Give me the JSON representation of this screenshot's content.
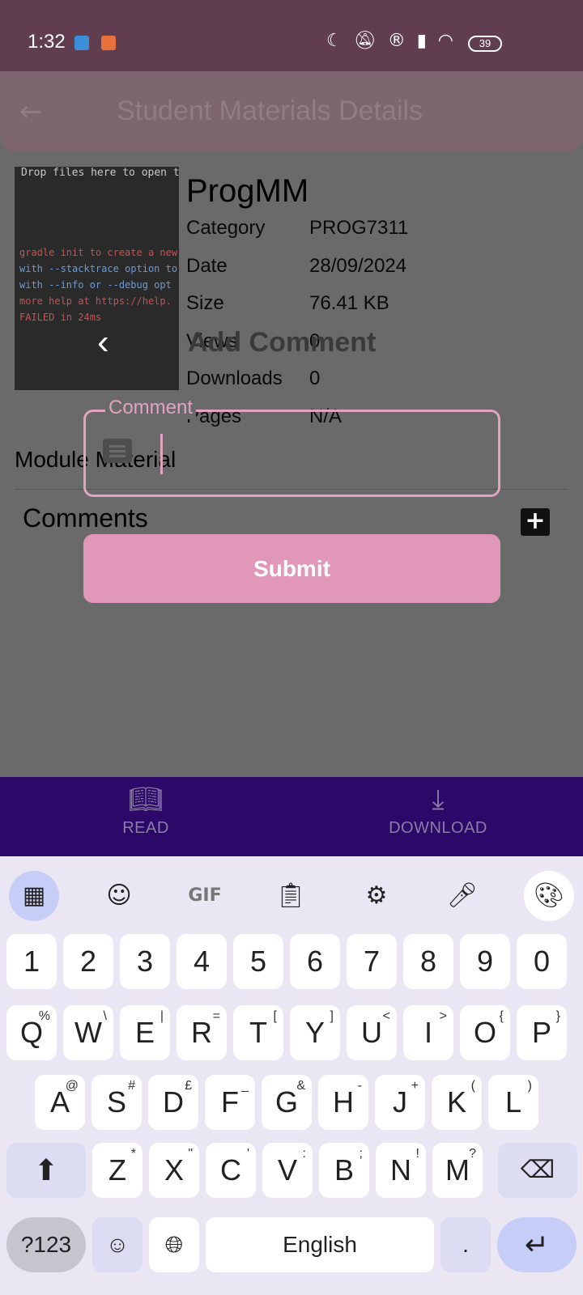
{
  "status_bar": {
    "time": "1:32",
    "battery": "39"
  },
  "app_bar": {
    "title": "Student Materials Details",
    "back_icon": "arrow-back-icon"
  },
  "material": {
    "preview_lines": [
      "Drop files here to open them",
      "gradle init to create a new",
      "with --stacktrace option to",
      "with --info or --debug opt",
      "more help at https://help.",
      "FAILED in 24ms"
    ],
    "title": "ProgMM",
    "details": [
      {
        "label": "Category",
        "value": "PROG7311"
      },
      {
        "label": "Date",
        "value": "28/09/2024"
      },
      {
        "label": "Size",
        "value": "76.41 KB"
      },
      {
        "label": "Views",
        "value": "0"
      },
      {
        "label": "Downloads",
        "value": "0"
      },
      {
        "label": "Pages",
        "value": "N/A"
      }
    ]
  },
  "sections": {
    "module_material": "Module Material",
    "comments": "Comments"
  },
  "dialog": {
    "title": "Add Comment",
    "field_label": "Comment",
    "field_value": "",
    "submit_label": "Submit"
  },
  "bottom_nav": {
    "read_label": "READ",
    "download_label": "DOWNLOAD"
  },
  "keyboard": {
    "number_row": [
      "1",
      "2",
      "3",
      "4",
      "5",
      "6",
      "7",
      "8",
      "9",
      "0"
    ],
    "row1": [
      {
        "key": "Q",
        "sup": "%"
      },
      {
        "key": "W",
        "sup": "\\"
      },
      {
        "key": "E",
        "sup": "|"
      },
      {
        "key": "R",
        "sup": "="
      },
      {
        "key": "T",
        "sup": "["
      },
      {
        "key": "Y",
        "sup": "]"
      },
      {
        "key": "U",
        "sup": "<"
      },
      {
        "key": "I",
        "sup": ">"
      },
      {
        "key": "O",
        "sup": "{"
      },
      {
        "key": "P",
        "sup": "}"
      }
    ],
    "row2": [
      {
        "key": "A",
        "sup": "@"
      },
      {
        "key": "S",
        "sup": "#"
      },
      {
        "key": "D",
        "sup": "£"
      },
      {
        "key": "F",
        "sup": "_"
      },
      {
        "key": "G",
        "sup": "&"
      },
      {
        "key": "H",
        "sup": "-"
      },
      {
        "key": "J",
        "sup": "+"
      },
      {
        "key": "K",
        "sup": "("
      },
      {
        "key": "L",
        "sup": ")"
      }
    ],
    "row3": [
      {
        "key": "Z",
        "sup": "*"
      },
      {
        "key": "X",
        "sup": "\""
      },
      {
        "key": "C",
        "sup": "'"
      },
      {
        "key": "V",
        "sup": ":"
      },
      {
        "key": "B",
        "sup": ";"
      },
      {
        "key": "N",
        "sup": "!"
      },
      {
        "key": "M",
        "sup": "?"
      }
    ],
    "symbols_label": "?123",
    "space_label": "English",
    "period": "."
  }
}
